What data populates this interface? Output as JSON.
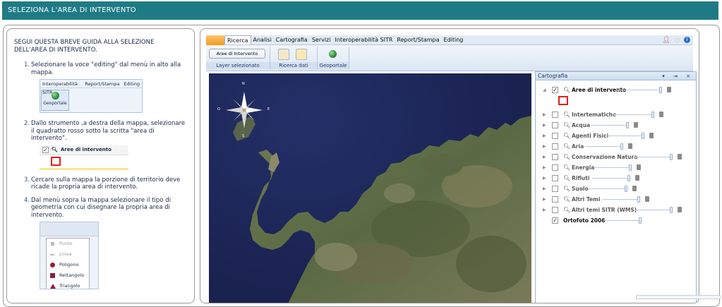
{
  "header": {
    "title": "SELEZIONA L'AREA DI INTERVENTO"
  },
  "guide": {
    "title": "SEGUI QUESTA BREVE GUIDA ALLA SELEZIONE DELL'AREA DI INTERVENTO.",
    "steps": [
      {
        "num": "1.",
        "text": "Selezionare la voce \"editing\" dal menù in alto alla mappa."
      },
      {
        "num": "2.",
        "text": "Dallo strumento ,a destra della mappa, selezionare il quadratto rosso sotto la scritta \"area di intervento\"."
      },
      {
        "num": "3.",
        "text": "Cercare sulla mappa la porzione di territorio deve ricade la propria area di intervento."
      },
      {
        "num": "4.",
        "text": "Dal menù sopra la mappa selezionare il tipo di geometria con cui disegnare la propria area di intervento."
      }
    ],
    "mini_menu": [
      "Interoperabilità SITR",
      "Report/Stampa",
      "Editing"
    ],
    "mini_tile": "Geoportale",
    "mini_layer": "Aree di intervento",
    "geometry_items": [
      {
        "label": "Punto",
        "enabled": false
      },
      {
        "label": "Linea",
        "enabled": false
      },
      {
        "label": "Poligono",
        "enabled": true
      },
      {
        "label": "Rettangolo",
        "enabled": true
      },
      {
        "label": "Triangolo",
        "enabled": true
      }
    ]
  },
  "app": {
    "menu": [
      "Ricerca",
      "Analisi",
      "Cartografia",
      "Servizi",
      "Interoperabilità SITR",
      "Report/Stampa",
      "Editing"
    ],
    "active_menu": "Ricerca",
    "ribbon": {
      "aree_button": "Aree di Intervento",
      "groups": [
        "Layer selezionato",
        "Ricerca dati",
        "Geoportale"
      ]
    },
    "compass": {
      "n": "N",
      "s": "S",
      "e": "E",
      "o": "O"
    },
    "panel": {
      "title": "Cartografia",
      "controls": "▾ ⇥ ×",
      "layers": [
        {
          "name": "Aree di intervento",
          "checked": true,
          "expanded": true
        },
        {
          "name": "Intertematiche",
          "checked": false
        },
        {
          "name": "Acqua",
          "checked": false
        },
        {
          "name": "Agenti Fisici",
          "checked": false
        },
        {
          "name": "Aria",
          "checked": false
        },
        {
          "name": "Conservazione Natura",
          "checked": false
        },
        {
          "name": "Energia",
          "checked": false
        },
        {
          "name": "Rifiuti",
          "checked": false
        },
        {
          "name": "Suolo",
          "checked": false
        },
        {
          "name": "Altri Temi",
          "checked": false
        },
        {
          "name": "Altri temi SITR (WMS)",
          "checked": false
        }
      ],
      "base_layer": {
        "name": "Ortofoto 2006",
        "checked": true
      }
    }
  },
  "colors": {
    "header": "#1e7b86",
    "red_marker": "#e0201c",
    "sea": "#1b2352"
  }
}
